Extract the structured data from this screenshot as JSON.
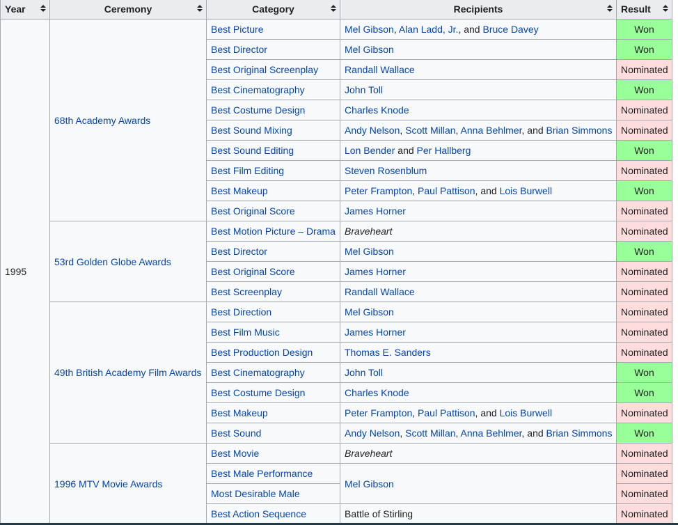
{
  "headers": {
    "year": "Year",
    "ceremony": "Ceremony",
    "category": "Category",
    "recipients": "Recipients",
    "result": "Result"
  },
  "year": "1995",
  "ceremonies": [
    "68th Academy Awards",
    "53rd Golden Globe Awards",
    "49th British Academy Film Awards",
    "1996 MTV Movie Awards"
  ],
  "rows": [
    {
      "category": "Best Picture",
      "result": "Won",
      "recipients": [
        {
          "t": "Mel Gibson",
          "link": true
        },
        {
          "t": ", "
        },
        {
          "t": "Alan Ladd, Jr.",
          "link": true
        },
        {
          "t": ", and "
        },
        {
          "t": "Bruce Davey",
          "link": true
        }
      ]
    },
    {
      "category": "Best Director",
      "result": "Won",
      "recipients": [
        {
          "t": "Mel Gibson",
          "link": true,
          "visited": true
        }
      ]
    },
    {
      "category": "Best Original Screenplay",
      "result": "Nominated",
      "recipients": [
        {
          "t": "Randall Wallace",
          "link": true
        }
      ]
    },
    {
      "category": "Best Cinematography",
      "result": "Won",
      "recipients": [
        {
          "t": "John Toll",
          "link": true
        }
      ]
    },
    {
      "category": "Best Costume Design",
      "result": "Nominated",
      "recipients": [
        {
          "t": "Charles Knode",
          "link": true
        }
      ]
    },
    {
      "category": "Best Sound Mixing",
      "result": "Nominated",
      "recipients": [
        {
          "t": "Andy Nelson",
          "link": true
        },
        {
          "t": ", "
        },
        {
          "t": "Scott Millan",
          "link": true
        },
        {
          "t": ", "
        },
        {
          "t": "Anna Behlmer",
          "link": true
        },
        {
          "t": ", and "
        },
        {
          "t": "Brian Simmons",
          "link": true
        }
      ]
    },
    {
      "category": "Best Sound Editing",
      "result": "Won",
      "recipients": [
        {
          "t": "Lon Bender",
          "link": true
        },
        {
          "t": " and "
        },
        {
          "t": "Per Hallberg",
          "link": true
        }
      ]
    },
    {
      "category": "Best Film Editing",
      "result": "Nominated",
      "recipients": [
        {
          "t": "Steven Rosenblum",
          "link": true
        }
      ]
    },
    {
      "category": "Best Makeup",
      "result": "Won",
      "recipients": [
        {
          "t": "Peter Frampton",
          "link": true
        },
        {
          "t": ", "
        },
        {
          "t": "Paul Pattison",
          "link": true
        },
        {
          "t": ", and "
        },
        {
          "t": "Lois Burwell",
          "link": true
        }
      ]
    },
    {
      "category": "Best Original Score",
      "result": "Nominated",
      "recipients": [
        {
          "t": "James Horner",
          "link": true
        }
      ]
    },
    {
      "category": "Best Motion Picture – Drama",
      "result": "Nominated",
      "recipients": [
        {
          "t": "Braveheart",
          "italic": true
        }
      ]
    },
    {
      "category": "Best Director",
      "result": "Won",
      "recipients": [
        {
          "t": "Mel Gibson",
          "link": true,
          "visited": true
        }
      ]
    },
    {
      "category": "Best Original Score",
      "result": "Nominated",
      "recipients": [
        {
          "t": "James Horner",
          "link": true
        }
      ]
    },
    {
      "category": "Best Screenplay",
      "result": "Nominated",
      "recipients": [
        {
          "t": "Randall Wallace",
          "link": true
        }
      ]
    },
    {
      "category": "Best Direction",
      "result": "Nominated",
      "recipients": [
        {
          "t": "Mel Gibson",
          "link": true,
          "visited": true
        }
      ]
    },
    {
      "category": "Best Film Music",
      "result": "Nominated",
      "recipients": [
        {
          "t": "James Horner",
          "link": true
        }
      ]
    },
    {
      "category": "Best Production Design",
      "result": "Nominated",
      "recipients": [
        {
          "t": "Thomas E. Sanders",
          "link": true
        }
      ]
    },
    {
      "category": "Best Cinematography",
      "result": "Won",
      "recipients": [
        {
          "t": "John Toll",
          "link": true
        }
      ]
    },
    {
      "category": "Best Costume Design",
      "result": "Won",
      "recipients": [
        {
          "t": "Charles Knode",
          "link": true
        }
      ]
    },
    {
      "category": "Best Makeup",
      "result": "Nominated",
      "recipients": [
        {
          "t": "Peter Frampton",
          "link": true
        },
        {
          "t": ", "
        },
        {
          "t": "Paul Pattison",
          "link": true
        },
        {
          "t": ", and "
        },
        {
          "t": "Lois Burwell",
          "link": true
        }
      ]
    },
    {
      "category": "Best Sound",
      "result": "Won",
      "recipients": [
        {
          "t": "Andy Nelson",
          "link": true
        },
        {
          "t": ", "
        },
        {
          "t": "Scott Millan",
          "link": true
        },
        {
          "t": ", "
        },
        {
          "t": "Anna Behlmer",
          "link": true
        },
        {
          "t": ", and "
        },
        {
          "t": "Brian Simmons",
          "link": true
        }
      ]
    },
    {
      "category": "Best Movie",
      "result": "Nominated",
      "recipients": [
        {
          "t": "Braveheart",
          "italic": true
        }
      ]
    },
    {
      "category": "Best Male Performance",
      "result": "Nominated",
      "recipients": [
        {
          "t": "Mel Gibson",
          "link": true,
          "visited": true
        }
      ]
    },
    {
      "category": "Most Desirable Male",
      "result": "Nominated",
      "recipients": null
    },
    {
      "category": "Best Action Sequence",
      "result": "Nominated",
      "recipients": [
        {
          "t": "Battle of Stirling"
        }
      ]
    }
  ],
  "colors": {
    "won": "#99ff99",
    "nominated": "#ffdddd",
    "link": "#0645ad",
    "header_bg": "#eaecf0",
    "border": "#a2a9b1"
  }
}
